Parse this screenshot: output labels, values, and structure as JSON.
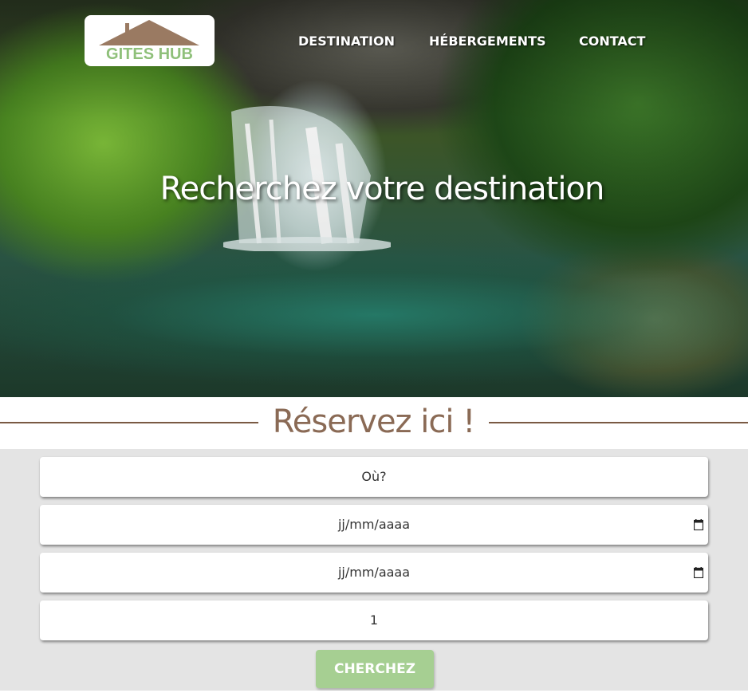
{
  "brand": {
    "name": "GITES HUB",
    "text_color": "#8fc07a",
    "roof_color": "#9a7a62"
  },
  "nav": {
    "items": [
      {
        "label": "DESTINATION"
      },
      {
        "label": "HÉBERGEMENTS"
      },
      {
        "label": "CONTACT"
      }
    ]
  },
  "hero": {
    "title": "Recherchez votre destination"
  },
  "reserve": {
    "title": "Réservez ici !",
    "accent": "#8a6a55"
  },
  "form": {
    "where": {
      "placeholder": "Où?"
    },
    "date_start": {
      "value": "jj/mm/aaaa",
      "icon": "calendar-icon"
    },
    "date_end": {
      "value": "jj/mm/aaaa",
      "icon": "calendar-icon"
    },
    "guests": {
      "value": "1"
    },
    "submit": {
      "label": "CHERCHEZ",
      "color": "#a6cf92"
    }
  }
}
